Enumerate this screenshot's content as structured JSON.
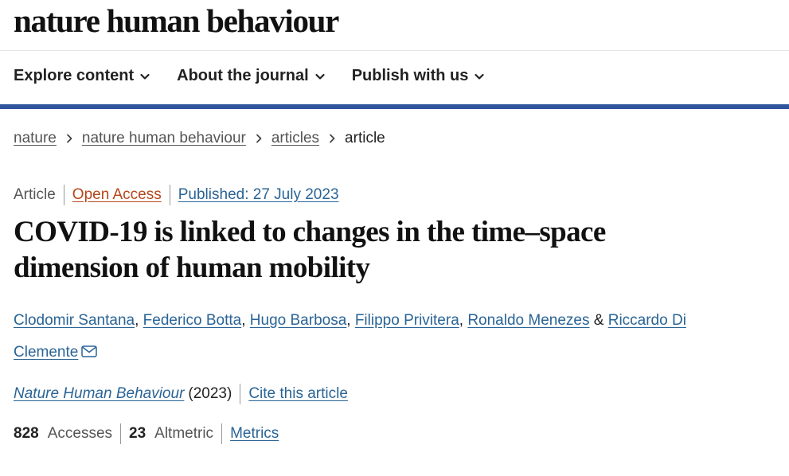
{
  "header": {
    "logo": "nature human behaviour"
  },
  "nav": {
    "items": [
      {
        "label": "Explore content",
        "icon": "chevron-down-icon"
      },
      {
        "label": "About the journal",
        "icon": "chevron-down-icon"
      },
      {
        "label": "Publish with us",
        "icon": "chevron-down-icon"
      }
    ]
  },
  "colors": {
    "accent_bar": "#2f559c",
    "link": "#2a6496",
    "open_access": "#b5461b"
  },
  "breadcrumb": {
    "items": [
      "nature",
      "nature human behaviour",
      "articles"
    ],
    "current": "article"
  },
  "article": {
    "type": "Article",
    "access": "Open Access",
    "published": "Published: 27 July 2023",
    "title": "COVID-19 is linked to changes in the time–space dimension of human mobility",
    "authors": [
      "Clodomir Santana",
      "Federico Botta",
      "Hugo Barbosa",
      "Filippo Privitera",
      "Ronaldo Menezes",
      "Riccardo Di Clemente"
    ],
    "separators": [
      ", ",
      ", ",
      ", ",
      ", ",
      " & "
    ],
    "journal_name": "Nature Human Behaviour",
    "journal_year": "(2023)",
    "cite_label": "Cite this article",
    "metrics": {
      "accesses_value": "828",
      "accesses_label": "Accesses",
      "altmetric_value": "23",
      "altmetric_label": "Altmetric",
      "link_label": "Metrics"
    }
  }
}
